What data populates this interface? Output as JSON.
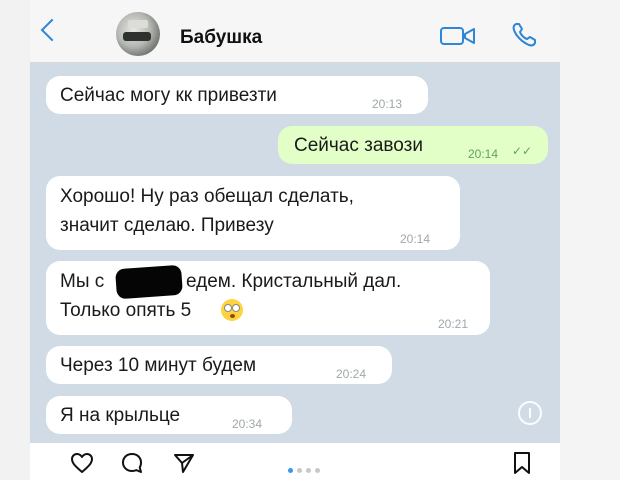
{
  "header": {
    "contact_name": "Бабушка",
    "back_icon": "chevron-left-icon",
    "video_icon": "video-call-icon",
    "phone_icon": "phone-icon"
  },
  "messages": [
    {
      "direction": "in",
      "lines": [
        "Сейчас могу кк привезти"
      ],
      "time": "20:13"
    },
    {
      "direction": "out",
      "lines": [
        "Сейчас завози"
      ],
      "time": "20:14",
      "read": true
    },
    {
      "direction": "in",
      "lines": [
        "Хорошо! Ну раз обещал сделать,",
        "значит сделаю. Привезу"
      ],
      "time": "20:14"
    },
    {
      "direction": "in",
      "line1_before": "Мы с",
      "line1_after": "едем. Кристальный дал.",
      "line2": "Только опять 5",
      "time": "20:21",
      "redacted": true,
      "emoji": "flushed-face-emoji"
    },
    {
      "direction": "in",
      "lines": [
        "Через 10 минут будем"
      ],
      "time": "20:24"
    },
    {
      "direction": "in",
      "lines": [
        "Я на крыльце"
      ],
      "time": "20:34"
    }
  ],
  "bottom_bar": {
    "like_icon": "heart-icon",
    "comment_icon": "comment-icon",
    "share_icon": "send-icon",
    "save_icon": "bookmark-icon",
    "carousel": {
      "total": 4,
      "active": 1
    }
  },
  "colors": {
    "chat_background": "#d1dbe6",
    "incoming_bubble": "#ffffff",
    "outgoing_bubble": "#e1ffc7",
    "accent": "#2f86d6",
    "carousel_active": "#3897f0"
  }
}
